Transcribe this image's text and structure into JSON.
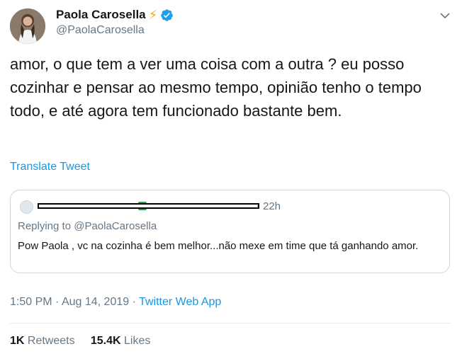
{
  "author": {
    "display_name": "Paola Carosella",
    "handle": "@PaolaCarosella",
    "name_emoji": "⚡"
  },
  "tweet": {
    "text": "amor, o que tem a ver uma coisa com a outra ? eu posso cozinhar e pensar ao mesmo tempo, opinião tenho o tempo todo, e até agora tem funcionado bastante bem.",
    "translate_label": "Translate Tweet",
    "time": "1:50 PM",
    "date": "Aug 14, 2019",
    "separator": "·",
    "source": "Twitter Web App"
  },
  "quoted": {
    "time": "22h",
    "replying_to": "Replying to @PaolaCarosella",
    "text": "Pow Paola , vc na cozinha é bem melhor...não mexe em time que tá ganhando amor."
  },
  "stats": {
    "retweets_count": "1K",
    "retweets_label": "Retweets",
    "likes_count": "15.4K",
    "likes_label": "Likes"
  },
  "colors": {
    "link": "#1b95e0",
    "secondary_text": "#657786",
    "verified": "#1da1f2",
    "bolt": "#f4a91a"
  }
}
